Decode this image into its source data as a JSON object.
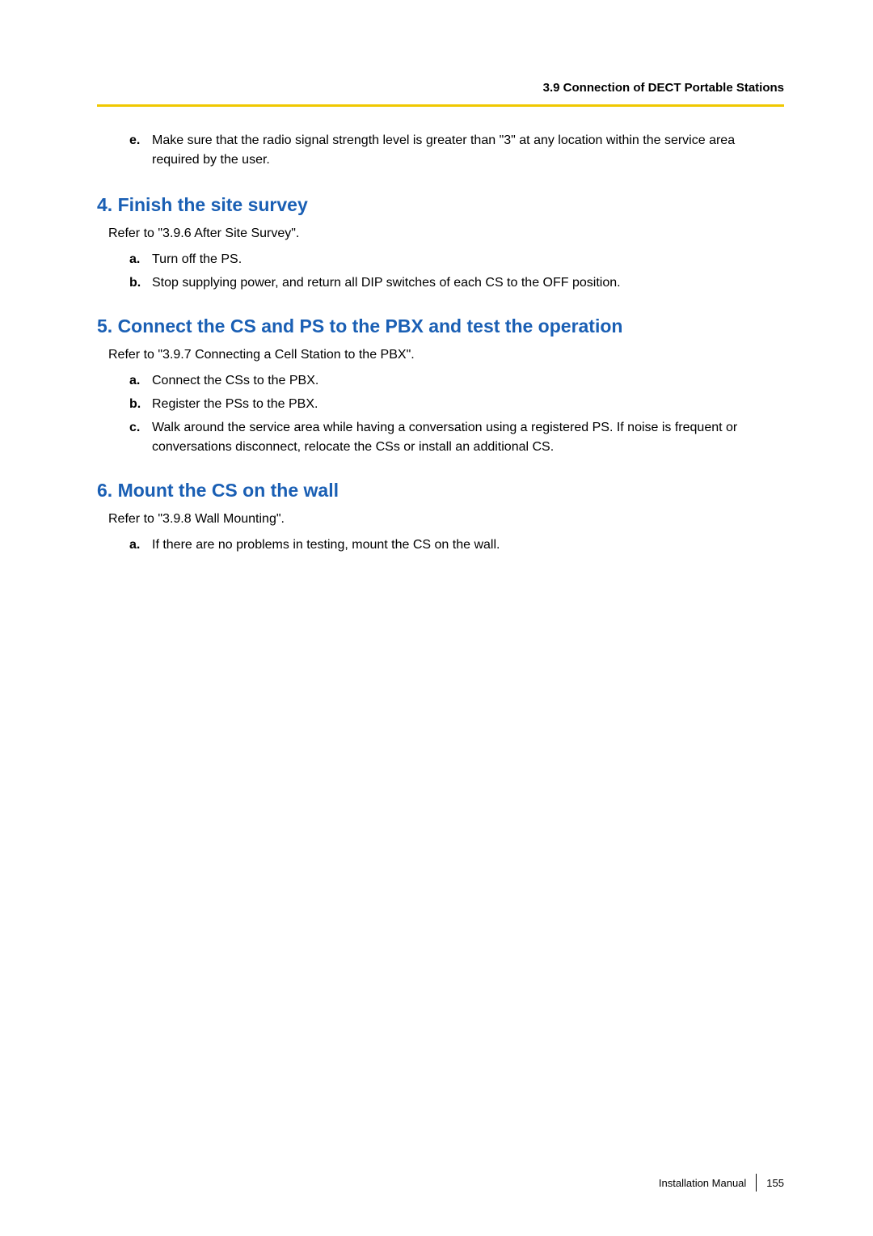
{
  "header": {
    "section_label": "3.9 Connection of DECT Portable Stations"
  },
  "continued": {
    "marker": "e.",
    "text": "Make sure that the radio signal strength level is greater than \"3\" at any location within the service area required by the user."
  },
  "sections": [
    {
      "title": "4. Finish the site survey",
      "refer": "Refer to \"3.9.6 After Site Survey\".",
      "items": [
        {
          "marker": "a.",
          "text": "Turn off the PS."
        },
        {
          "marker": "b.",
          "text": "Stop supplying power, and return all DIP switches of each CS to the OFF position."
        }
      ]
    },
    {
      "title": "5. Connect the CS and PS to the PBX and test the operation",
      "refer": "Refer to \"3.9.7 Connecting a Cell Station to the PBX\".",
      "items": [
        {
          "marker": "a.",
          "text": "Connect the CSs to the PBX."
        },
        {
          "marker": "b.",
          "text": "Register the PSs to the PBX."
        },
        {
          "marker": "c.",
          "text": "Walk around the service area while having a conversation using a registered PS. If noise is frequent or conversations disconnect, relocate the CSs or install an additional CS."
        }
      ]
    },
    {
      "title": "6. Mount the CS on the wall",
      "refer": "Refer to \"3.9.8 Wall Mounting\".",
      "items": [
        {
          "marker": "a.",
          "text": "If there are no problems in testing, mount the CS on the wall."
        }
      ]
    }
  ],
  "footer": {
    "manual": "Installation Manual",
    "page": "155"
  }
}
